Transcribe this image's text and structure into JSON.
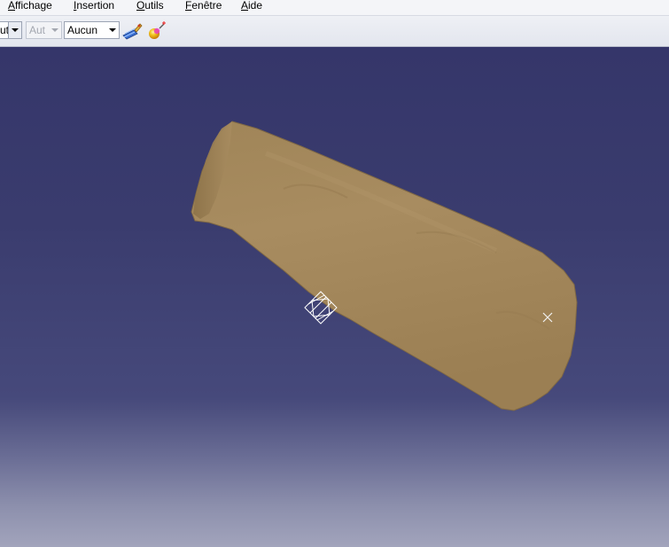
{
  "menu": {
    "items": [
      {
        "label": "Affichage",
        "accel": "A",
        "rest": "ffichage"
      },
      {
        "label": "Insertion",
        "accel": "I",
        "rest": "nsertion"
      },
      {
        "label": "Outils",
        "accel": "O",
        "rest": "utils"
      },
      {
        "label": "Fenêtre",
        "accel": "F",
        "rest": "enêtre"
      },
      {
        "label": "Aide",
        "accel": "A",
        "rest": "ide"
      }
    ]
  },
  "toolbar": {
    "combo_left_value": "ut",
    "combo_auto_value": "Aut",
    "combo_none_value": "Aucun",
    "icons": [
      "paint-brush-icon",
      "pink-ball-icon"
    ]
  },
  "viewport": {
    "object": "tubular-scan-mesh",
    "background_top": "#35366a",
    "background_bottom": "#a2a4bc",
    "object_color": "#a68a5f"
  },
  "colors": {
    "menu_bg": "#f4f5f8",
    "toolbar_bg": "#e3e6ee"
  }
}
